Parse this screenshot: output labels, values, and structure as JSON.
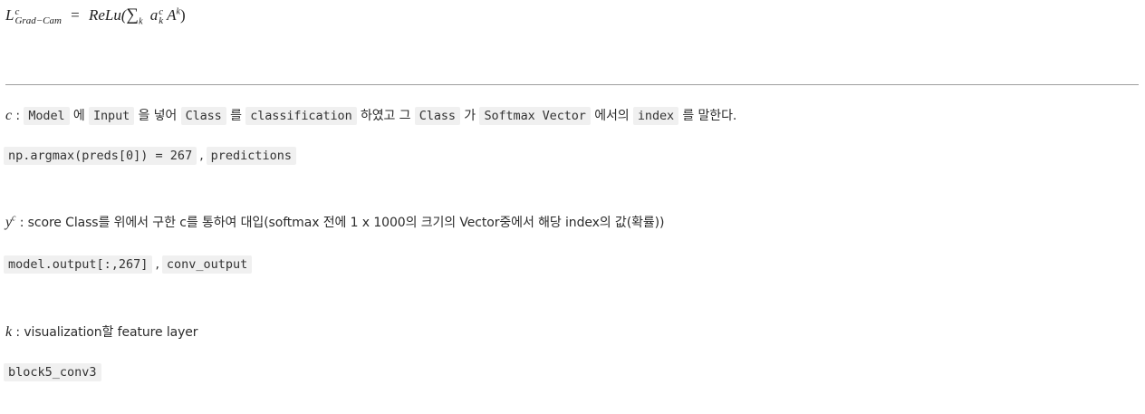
{
  "formula": {
    "lhs_base": "L",
    "lhs_sup": "c",
    "lhs_sub": "Grad−Cam",
    "equals": "=",
    "func": "ReLu(",
    "sum": "∑",
    "sum_sub": "k",
    "a_base": "a",
    "a_sup": "c",
    "a_sub": "k",
    "A_base": "A",
    "A_sup": "k",
    "close": ")"
  },
  "c_def": {
    "var": "c",
    "colon": ":",
    "t1_code": "Model",
    "t2": "에",
    "t3_code": "Input",
    "t4": "을 넣어",
    "t5_code": "Class",
    "t6": "를",
    "t7_code": "classification",
    "t8": "하였고 그",
    "t9_code": "Class",
    "t10": "가",
    "t11_code": "Softmax Vector",
    "t12": "에서의",
    "t13_code": "index",
    "t14": "를 말한다."
  },
  "c_code": {
    "code1": "np.argmax(preds[0]) = 267",
    "comma": ",",
    "code2": "predictions"
  },
  "y_def": {
    "var": "y",
    "sup": "c",
    "text": ": score Class를 위에서 구한 c를 통하여 대입(softmax 전에 1 x 1000의 크기의 Vector중에서 해당 index의 값(확률))"
  },
  "y_code": {
    "code1": "model.output[:,267]",
    "comma": ",",
    "code2": "conv_output"
  },
  "k_def": {
    "var": "k",
    "text": ": visualization할 feature layer"
  },
  "k_code": {
    "code1": "block5_conv3"
  }
}
